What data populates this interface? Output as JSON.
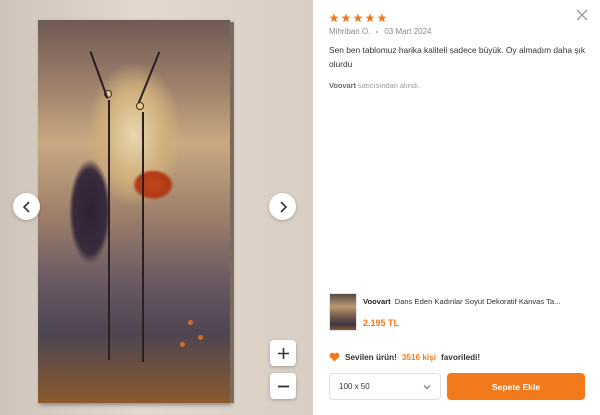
{
  "review": {
    "rating": 5,
    "author": "Mihriban O.",
    "date": "03 Mart 2024",
    "text": "Sen ben tablomuz harika kaliteli sadece büyük. Oy almadım daha şık olurdu",
    "seller_name": "Voovart",
    "seller_suffix": "satıcısından alındı."
  },
  "product": {
    "brand": "Voovart",
    "name": "Dans Eden Kadınlar Soyut Dekoratif Kanvas Ta...",
    "price": "2.195 TL"
  },
  "favorite": {
    "prefix": "Sevilen ürün!",
    "count_text": "3516 kişi",
    "suffix": "favoriledi!"
  },
  "size_select": {
    "selected": "100 x 50"
  },
  "add_to_cart": {
    "label": "Sepete Ekle"
  },
  "colors": {
    "accent": "#f27a1a",
    "star": "#f27a1a",
    "heart": "#f27a1a"
  },
  "icons": {
    "prev": "chevron-left-icon",
    "next": "chevron-right-icon",
    "zoom_in": "plus-icon",
    "zoom_out": "minus-icon",
    "close": "close-icon",
    "star": "star-icon",
    "heart": "heart-icon",
    "dropdown": "chevron-down-icon"
  }
}
